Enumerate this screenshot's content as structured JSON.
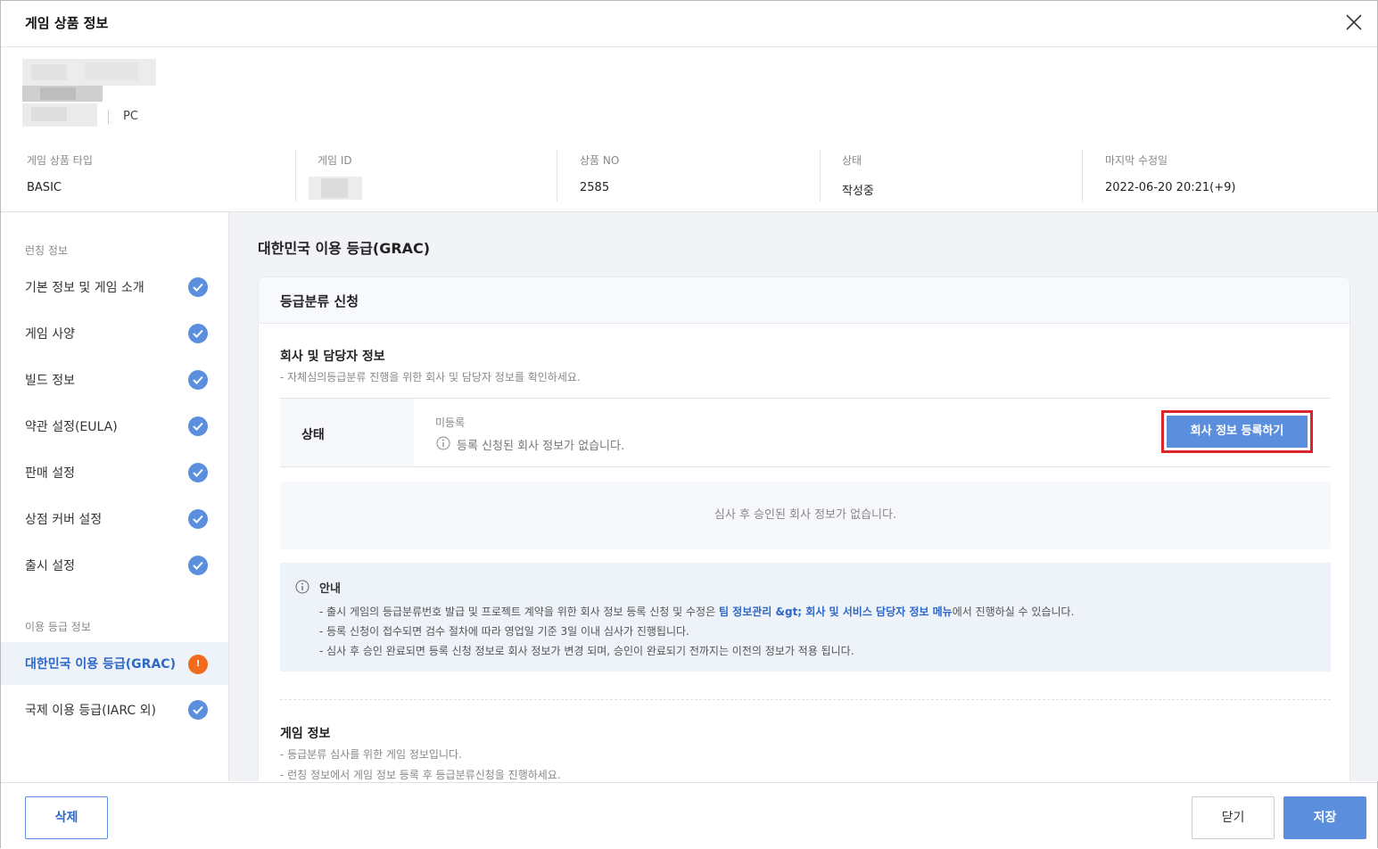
{
  "header": {
    "title": "게임 상품 정보"
  },
  "product": {
    "platform": "PC"
  },
  "meta": [
    {
      "label": "게임 상품 타입",
      "value": "BASIC"
    },
    {
      "label": "게임 ID",
      "value": ""
    },
    {
      "label": "상품 NO",
      "value": "2585"
    },
    {
      "label": "상태",
      "value": "작성중"
    },
    {
      "label": "마지막 수정일",
      "value": "2022-06-20 20:21(+9)"
    }
  ],
  "sidebar": {
    "section1": "런칭 정보",
    "section2": "이용 등급 정보",
    "items": [
      {
        "label": "기본 정보 및 게임 소개",
        "status": "done"
      },
      {
        "label": "게임 사양",
        "status": "done"
      },
      {
        "label": "빌드 정보",
        "status": "done"
      },
      {
        "label": "약관 설정(EULA)",
        "status": "done"
      },
      {
        "label": "판매 설정",
        "status": "done"
      },
      {
        "label": "상점 커버 설정",
        "status": "done"
      },
      {
        "label": "출시 설정",
        "status": "done"
      },
      {
        "label": "대한민국 이용 등급(GRAC)",
        "status": "warning",
        "active": true
      },
      {
        "label": "국제 이용 등급(IARC 외)",
        "status": "done"
      }
    ],
    "warning_mark": "!"
  },
  "main": {
    "title": "대한민국 이용 등급(GRAC)",
    "card_title": "등급분류 신청",
    "company": {
      "title": "회사 및 담당자 정보",
      "desc": "- 자체심의등급분류 진행을 위한 회사 및 담당자 정보를 확인하세요.",
      "status_key": "상태",
      "status_value": "미등록",
      "status_note": "등록 신청된 회사 정보가 없습니다.",
      "register_button": "회사 정보 등록하기",
      "empty_text": "심사 후 승인된 회사 정보가 없습니다."
    },
    "notice": {
      "title": "안내",
      "line1_pre": "- 출시 게임의 등급분류번호 발급 및 프로젝트 계약을 위한 회사 정보 등록 신청 및 수정은 ",
      "line1_link": "팀 정보관리 &gt; 회사 및 서비스 담당자 정보 메뉴",
      "line1_post": "에서 진행하실 수 있습니다.",
      "line2": "- 등록 신청이 접수되면 검수 절차에 따라 영업일 기준 3일 이내 심사가 진행됩니다.",
      "line3": "- 심사 후 승인 완료되면 등록 신청 정보로 회사 정보가 변경 되며, 승인이 완료되기 전까지는 이전의 정보가 적용 됩니다."
    },
    "game": {
      "title": "게임 정보",
      "desc1": "- 등급분류 심사를 위한 게임 정보입니다.",
      "desc2": "- 런칭 정보에서 게임 정보 등록 후 등급분류신청을 진행하세요."
    }
  },
  "footer": {
    "delete": "삭제",
    "close": "닫기",
    "save": "저장"
  },
  "colors": {
    "accent": "#5b8fdd",
    "warning": "#f26a1b",
    "highlight_border": "#d9252c"
  }
}
